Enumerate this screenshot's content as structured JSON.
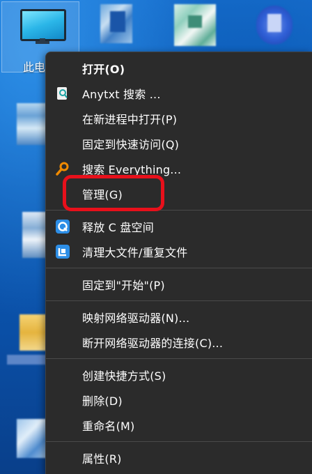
{
  "desktop": {
    "this_pc_label": "此电"
  },
  "context_menu": {
    "items": [
      {
        "label": "打开(O)",
        "bold": true
      },
      {
        "label": "Anytxt 搜索 ...",
        "icon": "anytxt-search-icon"
      },
      {
        "label": "在新进程中打开(P)"
      },
      {
        "label": "固定到快速访问(Q)"
      },
      {
        "label": "搜索 Everything...",
        "icon": "everything-search-icon"
      },
      {
        "label": "管理(G)",
        "highlighted": true
      },
      {
        "label": "释放 C 盘空间",
        "icon": "free-space-icon"
      },
      {
        "label": "清理大文件/重复文件",
        "icon": "cleanup-files-icon"
      },
      {
        "label": "固定到\"开始\"(P)"
      },
      {
        "label": "映射网络驱动器(N)..."
      },
      {
        "label": "断开网络驱动器的连接(C)..."
      },
      {
        "label": "创建快捷方式(S)"
      },
      {
        "label": "删除(D)"
      },
      {
        "label": "重命名(M)"
      },
      {
        "label": "属性(R)"
      }
    ]
  },
  "annotation": {
    "color": "#e8101b"
  }
}
